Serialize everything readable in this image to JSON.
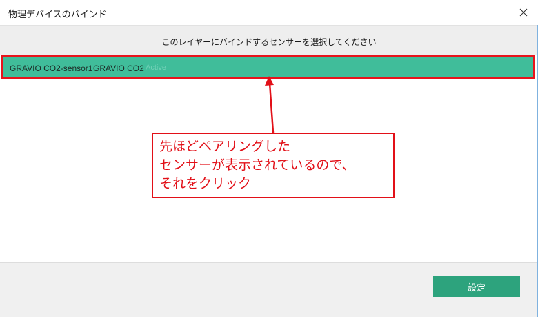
{
  "window": {
    "title": "物理デバイスのバインド",
    "close_icon": "close-icon"
  },
  "prompt": "このレイヤーにバインドするセンサーを選択してください",
  "sensors": [
    {
      "name": "GRAVIO CO2-sensor1",
      "type": "GRAVIO CO2",
      "state": "Active",
      "selected": true
    }
  ],
  "footer": {
    "set_label": "設定"
  },
  "annotation": {
    "lines": [
      "先ほどペアリングした",
      "センサーが表示されているので、",
      "それをクリック"
    ],
    "color": "#e21018"
  },
  "colors": {
    "selected_row": "#40bd9a",
    "highlight_border": "#e8141c",
    "button": "#2da37d"
  }
}
